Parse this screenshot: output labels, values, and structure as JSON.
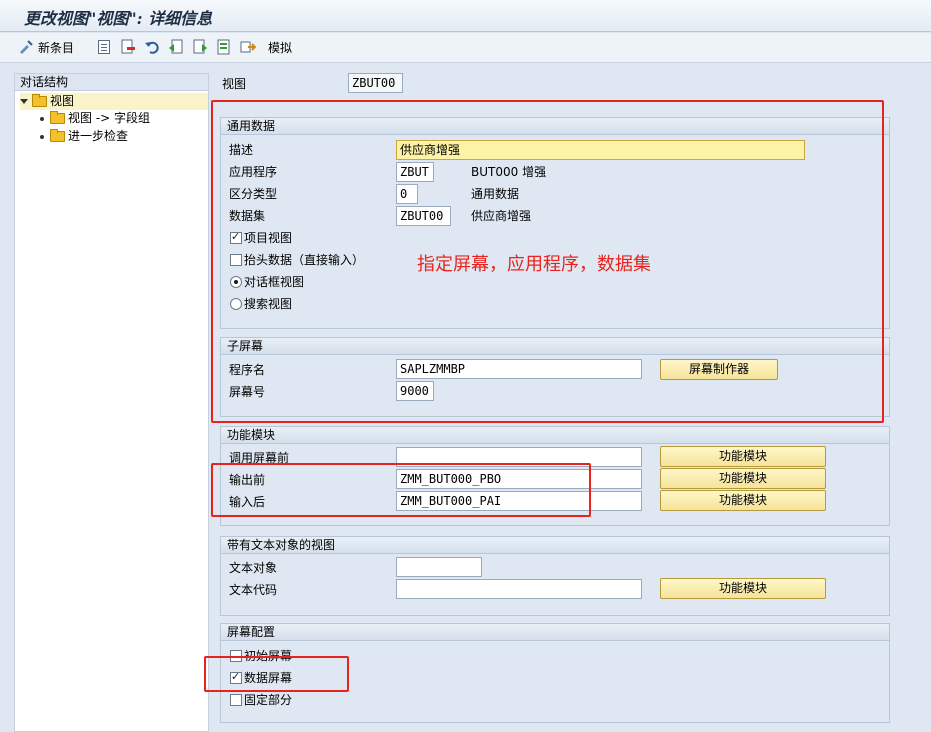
{
  "window": {
    "title": "更改视图\"视图\": 详细信息"
  },
  "toolbar": {
    "new_entries_label": "新条目",
    "simulate_label": "模拟"
  },
  "tree": {
    "header": "对话结构",
    "items": [
      {
        "label": "视图",
        "level": 0,
        "expanded": true,
        "selected": true
      },
      {
        "label": "视图 -> 字段组",
        "level": 1
      },
      {
        "label": "进一步检查",
        "level": 1
      }
    ]
  },
  "main": {
    "view_label": "视图",
    "view_value": "ZBUT00",
    "general": {
      "title": "通用数据",
      "desc_label": "描述",
      "desc_value": "供应商增强",
      "app_label": "应用程序",
      "app_value": "ZBUT",
      "app_text": "BUT000 增强",
      "diff_label": "区分类型",
      "diff_value": "0",
      "diff_text": "通用数据",
      "dataset_label": "数据集",
      "dataset_value": "ZBUT00",
      "dataset_text": "供应商增强",
      "item_view_label": "项目视图",
      "item_view_checked": true,
      "header_data_label": "抬头数据（直接输入）",
      "header_data_checked": false,
      "dialog_view_label": "对话框视图",
      "dialog_view_selected": true,
      "search_view_label": "搜索视图",
      "search_view_selected": false
    },
    "subscreen": {
      "title": "子屏幕",
      "program_label": "程序名",
      "program_value": "SAPLZMMBP",
      "screen_label": "屏幕号",
      "screen_value": "9000",
      "painter_button": "屏幕制作器"
    },
    "function_modules": {
      "title": "功能模块",
      "call_before_label": "调用屏幕前",
      "call_before_value": "",
      "before_output_label": "输出前",
      "before_output_value": "ZMM_BUT000_PBO",
      "after_input_label": "输入后",
      "after_input_value": "ZMM_BUT000_PAI",
      "button_label": "功能模块"
    },
    "text_object": {
      "title": "带有文本对象的视图",
      "object_label": "文本对象",
      "object_value": "",
      "code_label": "文本代码",
      "code_value": "",
      "button_label": "功能模块"
    },
    "screen_config": {
      "title": "屏幕配置",
      "initial_label": "初始屏幕",
      "initial_checked": false,
      "data_label": "数据屏幕",
      "data_checked": true,
      "fixed_label": "固定部分",
      "fixed_checked": false
    }
  },
  "annotation": {
    "text": "指定屏幕，应用程序，数据集",
    "color": "#e8231e"
  },
  "colors": {
    "accent_yellow": "#f6e49a",
    "annotation_red": "#e8231e",
    "panel_bg": "#dfe8f2"
  }
}
